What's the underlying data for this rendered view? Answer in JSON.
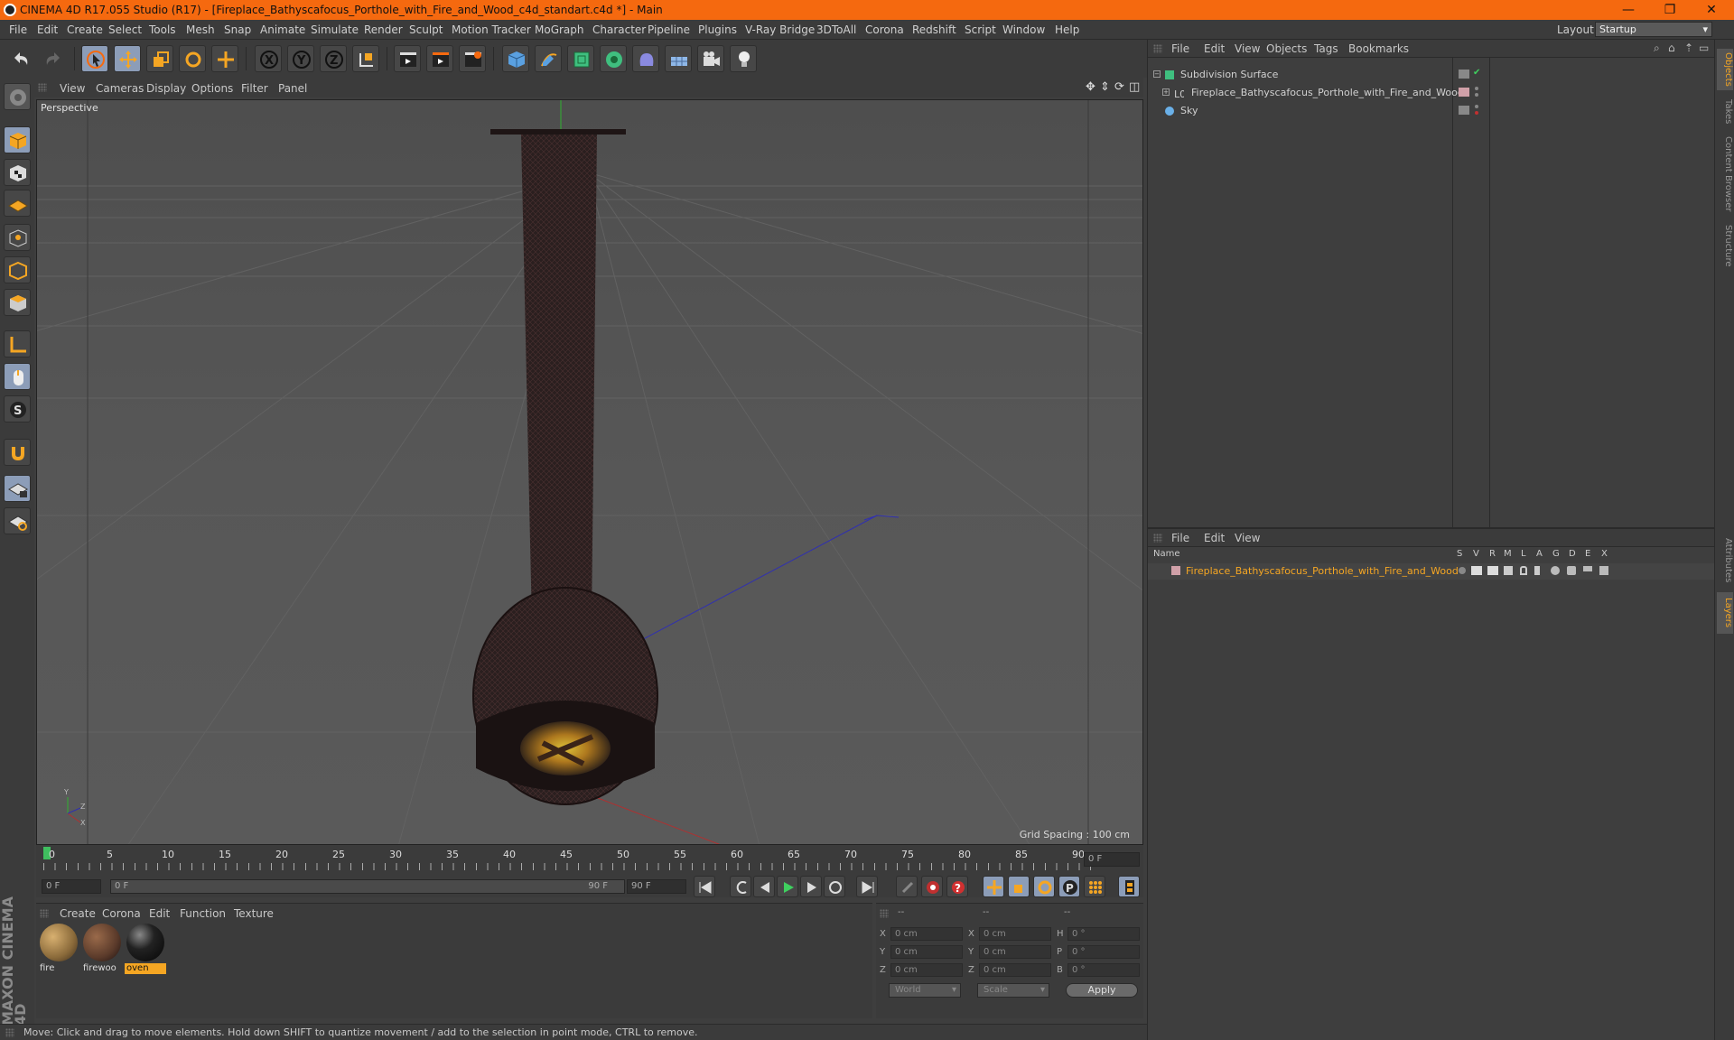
{
  "window": {
    "title": "CINEMA 4D R17.055 Studio (R17) - [Fireplace_Bathyscafocus_Porthole_with_Fire_and_Wood_c4d_standart.c4d *] - Main",
    "minimize_icon": "—",
    "restore_icon": "❐",
    "close_icon": "✕"
  },
  "menu": {
    "items": [
      "File",
      "Edit",
      "Create",
      "Select",
      "Tools",
      "Mesh",
      "Snap",
      "Animate",
      "Simulate",
      "Render",
      "Sculpt",
      "Motion Tracker",
      "MoGraph",
      "Character",
      "Pipeline",
      "Plugins",
      "V-Ray Bridge",
      "3DToAll",
      "Corona",
      "Redshift",
      "Script",
      "Window",
      "Help"
    ],
    "layout_label": "Layout:",
    "layout_value": "Startup"
  },
  "viewport": {
    "menu": [
      "View",
      "Cameras",
      "Display",
      "Options",
      "Filter",
      "Panel"
    ],
    "label": "Perspective",
    "grid_spacing": "Grid Spacing : 100 cm",
    "axis_y": "Y",
    "axis_z": "Z",
    "axis_x": "X"
  },
  "timeline": {
    "ticks": [
      "0",
      "5",
      "10",
      "15",
      "20",
      "25",
      "30",
      "35",
      "40",
      "45",
      "50",
      "55",
      "60",
      "65",
      "70",
      "75",
      "80",
      "85",
      "90"
    ],
    "current_frame": "0 F"
  },
  "transport": {
    "start_field": "0 F",
    "slider_start": "0 F",
    "slider_end": "90 F",
    "end_field": "90 F"
  },
  "materials": {
    "menu": [
      "Create",
      "Corona",
      "Edit",
      "Function",
      "Texture"
    ],
    "items": [
      {
        "label": "fire",
        "color": "#8a6a3a"
      },
      {
        "label": "firewoo",
        "color": "#5a3a2a"
      },
      {
        "label": "oven",
        "color": "#101010"
      }
    ]
  },
  "coordinates": {
    "headers": [
      "--",
      "--",
      "--"
    ],
    "rows": [
      {
        "a": "X",
        "av": "0 cm",
        "b": "X",
        "bv": "0 cm",
        "c": "H",
        "cv": "0 °"
      },
      {
        "a": "Y",
        "av": "0 cm",
        "b": "Y",
        "bv": "0 cm",
        "c": "P",
        "cv": "0 °"
      },
      {
        "a": "Z",
        "av": "0 cm",
        "b": "Z",
        "bv": "0 cm",
        "c": "B",
        "cv": "0 °"
      }
    ],
    "world": "World",
    "scale": "Scale",
    "apply": "Apply"
  },
  "status": {
    "text": "Move: Click and drag to move elements. Hold down SHIFT to quantize movement / add to the selection in point mode, CTRL to remove."
  },
  "objects_panel": {
    "menu": [
      "File",
      "Edit",
      "View",
      "Objects",
      "Tags",
      "Bookmarks"
    ],
    "objects": [
      {
        "name": "Subdivision Surface",
        "color": "#d0d0d0"
      },
      {
        "name": "Fireplace_Bathyscafocus_Porthole_with_Fire_and_Wood",
        "color": "#d0d0d0"
      },
      {
        "name": "Sky",
        "color": "#d0d0d0"
      }
    ]
  },
  "layers_panel": {
    "menu": [
      "File",
      "Edit",
      "View"
    ],
    "name_header": "Name",
    "col_headers": [
      "S",
      "V",
      "R",
      "M",
      "L",
      "A",
      "G",
      "D",
      "E",
      "X"
    ],
    "layer_name": "Fireplace_Bathyscafocus_Porthole_with_Fire_and_Wood",
    "layer_color": "#f5a623"
  },
  "right_tabs": [
    "Objects",
    "Takes",
    "Content Browser",
    "Structure",
    "Attributes",
    "Layers"
  ],
  "branding": "MAXON CINEMA 4D",
  "colors": {
    "accent": "#f5690f",
    "selected_tool": "#8c9db8",
    "highlight": "#f5a623"
  }
}
